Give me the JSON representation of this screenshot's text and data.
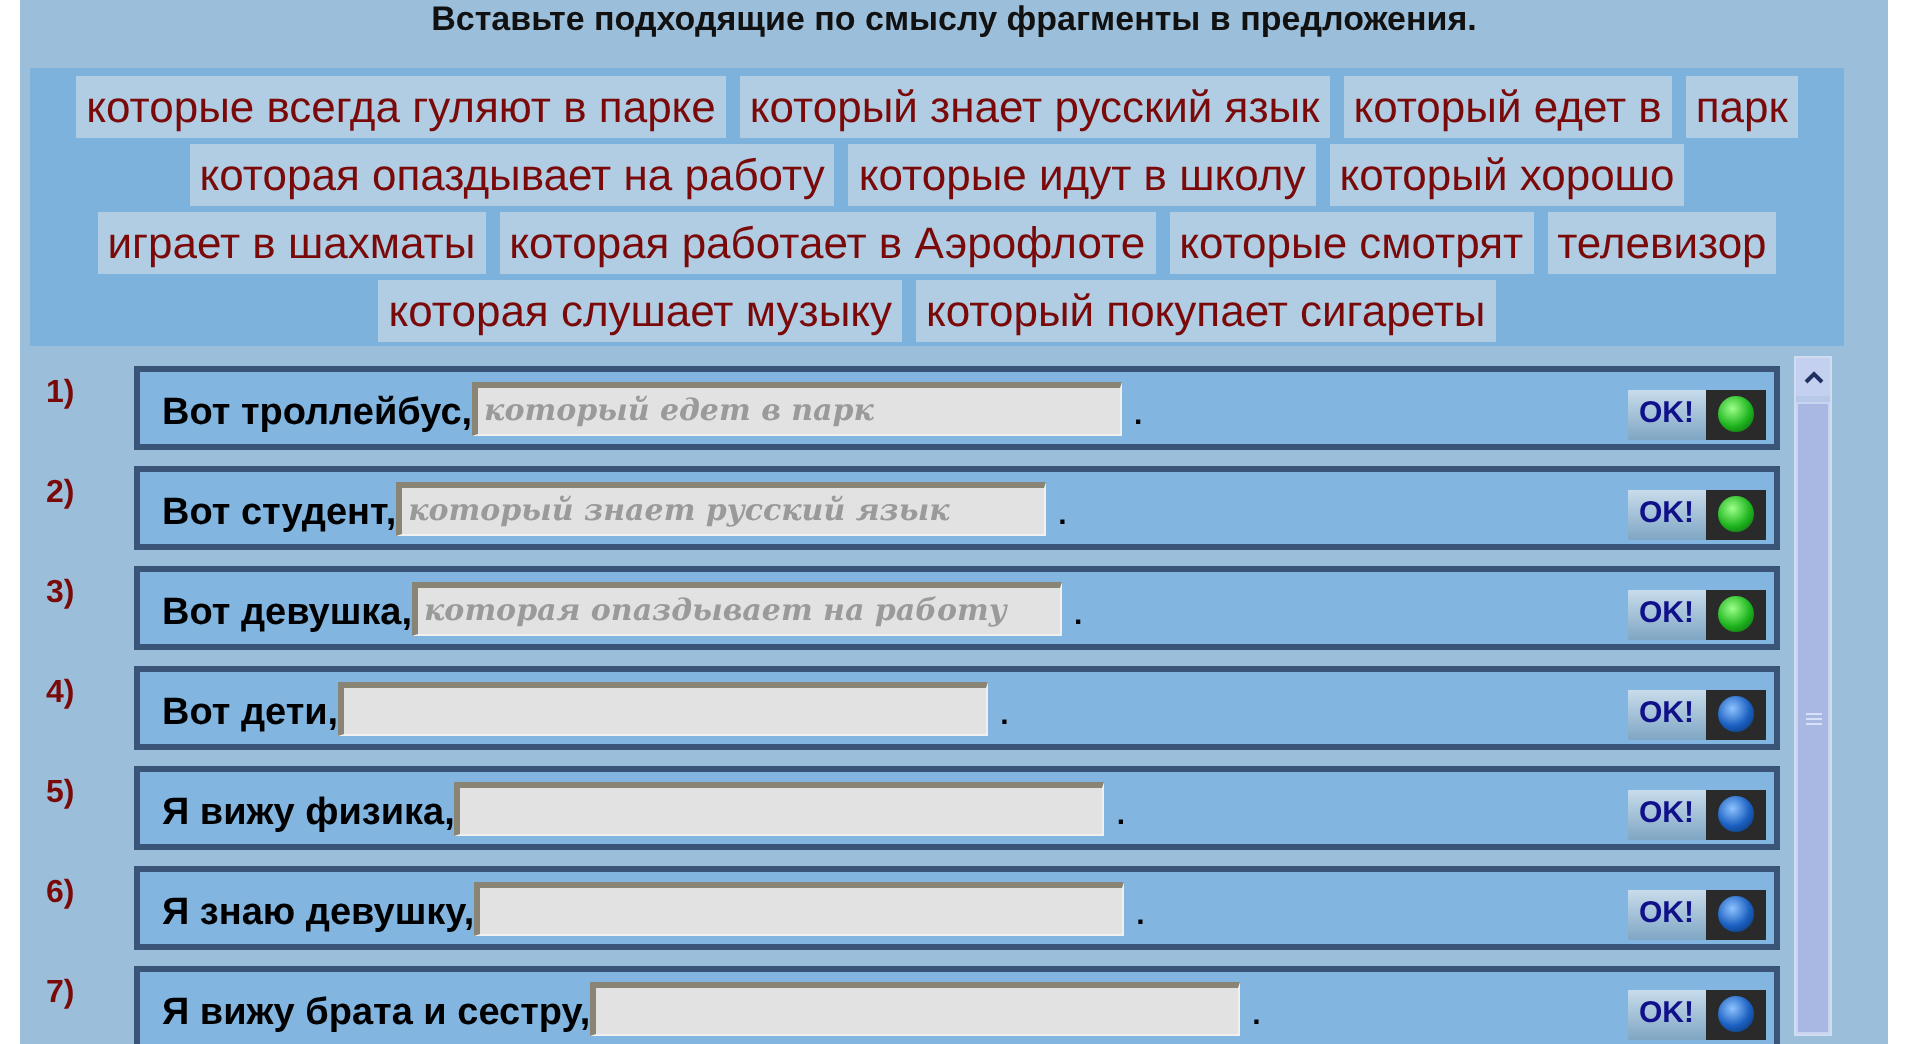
{
  "heading": "Вставьте подходящие по смыслу фрагменты в предложения.",
  "fragments": [
    [
      "которые всегда гуляют в парке"
    ],
    [
      "который знает русский язык"
    ],
    [
      "который едет в",
      "парк"
    ],
    [
      "которая опаздывает на работу"
    ],
    [
      "которые идут в школу"
    ],
    [
      "который хорошо",
      "играет в шахматы"
    ],
    [
      "которая работает в Аэрофлоте"
    ],
    [
      "которые смотрят",
      "телевизор"
    ],
    [
      "которая слушает музыку"
    ],
    [
      "который покупает сигареты"
    ]
  ],
  "sentences": [
    {
      "number": "1)",
      "text": "Вот троллейбус,",
      "value": "который едет в парк",
      "end": ".",
      "button": "OK!",
      "correct": true
    },
    {
      "number": "2)",
      "text": "Вот студент,",
      "value": "который знает русский язык",
      "end": ".",
      "button": "OK!",
      "correct": true
    },
    {
      "number": "3)",
      "text": "Вот девушка,",
      "value": "которая опаздывает на работу",
      "end": ".",
      "button": "OK!",
      "correct": true
    },
    {
      "number": "4)",
      "text": "Вот дети,",
      "end": ".",
      "button": "OK!",
      "correct": false
    },
    {
      "number": "5)",
      "text": "Я вижу физика,",
      "end": ".",
      "button": "OK!",
      "correct": false
    },
    {
      "number": "6)",
      "text": "Я знаю девушку,",
      "end": ".",
      "button": "OK!",
      "correct": false
    },
    {
      "number": "7)",
      "text": "Я вижу брата и сестру,",
      "end": ".",
      "button": "OK!",
      "correct": false
    }
  ]
}
